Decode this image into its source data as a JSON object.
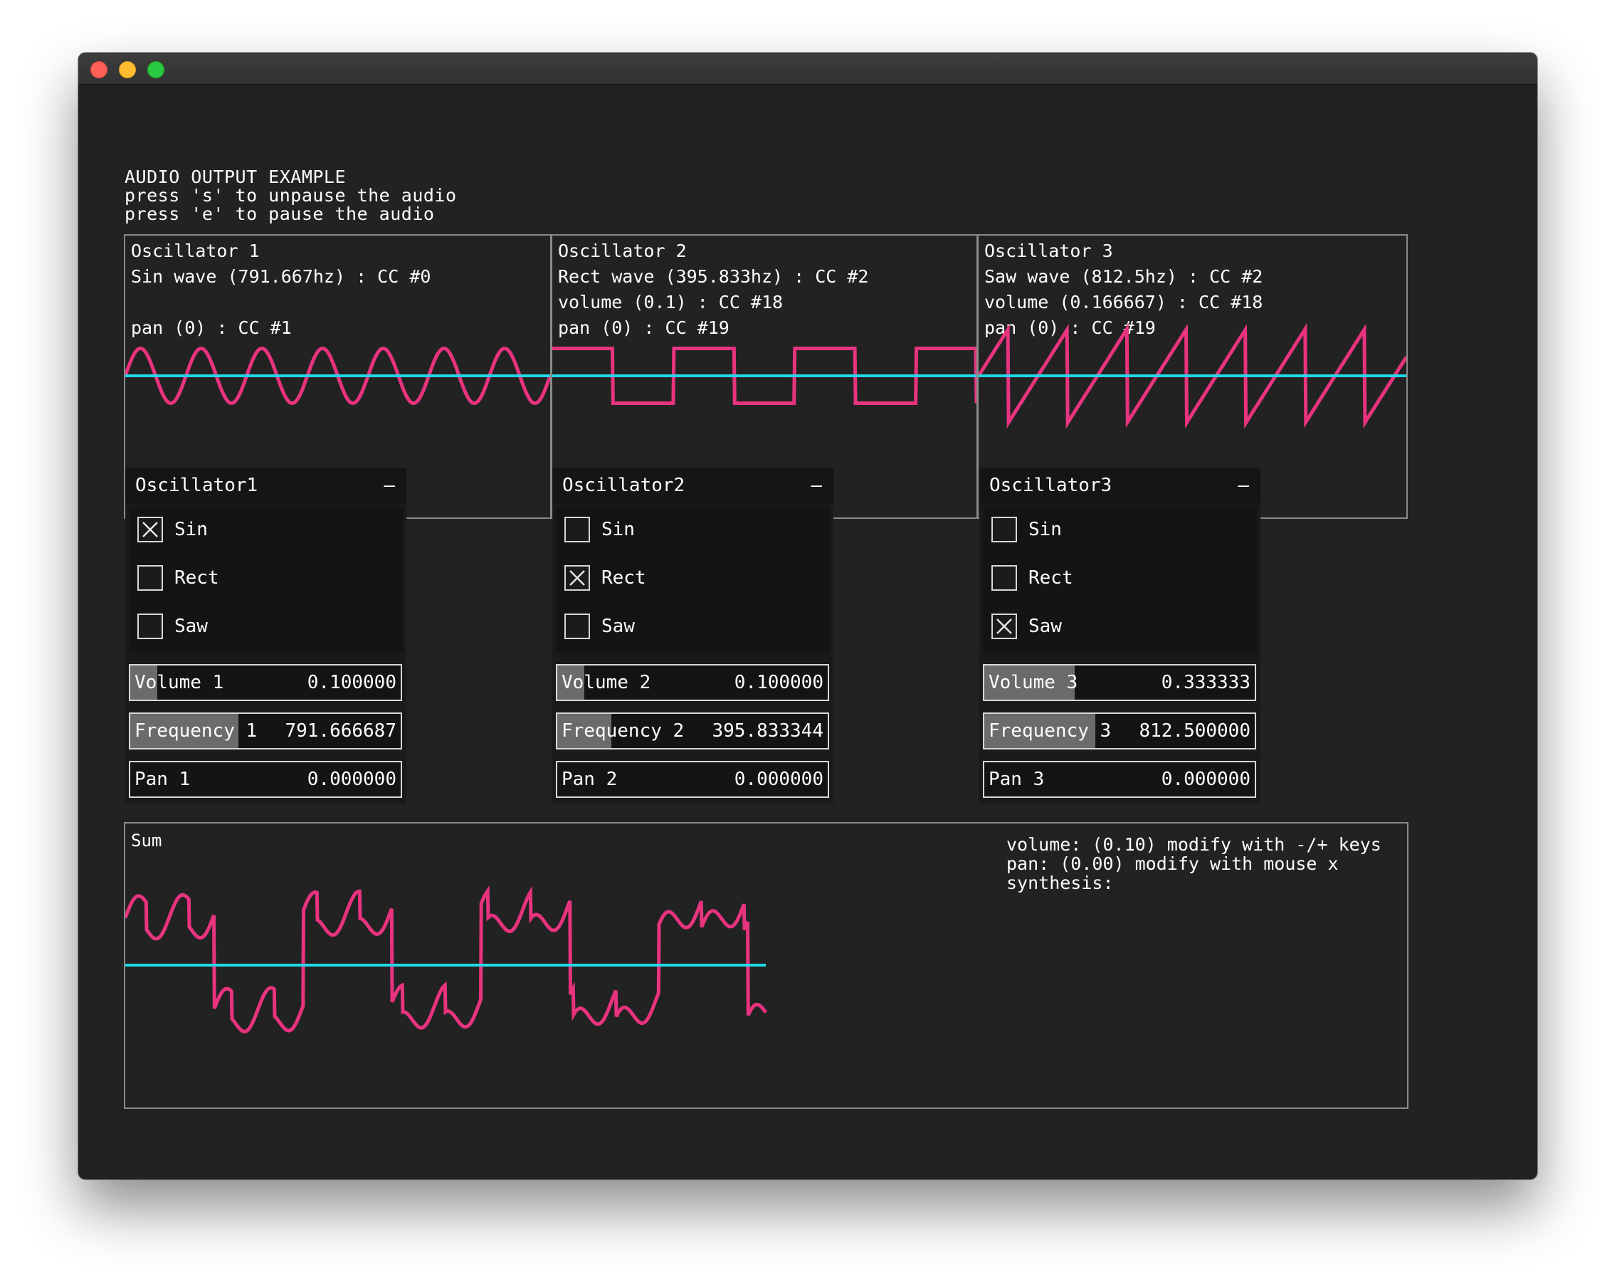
{
  "colors": {
    "wave": "#e8337f",
    "baseline": "#22d8e6",
    "border": "#8a8a8a",
    "background": "#222222"
  },
  "header": {
    "line1": "AUDIO OUTPUT EXAMPLE",
    "line2": "press 's' to unpause the audio",
    "line3": "press 'e' to pause the audio"
  },
  "scopes": [
    {
      "title": "Oscillator 1",
      "line2": "Sin wave (791.667hz) : CC #0",
      "line3": "",
      "line4": "pan (0) : CC #1",
      "wave": "sin",
      "cycles": 7,
      "amplitude": 0.35
    },
    {
      "title": "Oscillator 2",
      "line2": "Rect wave (395.833hz) : CC #2",
      "line3": "volume (0.1) : CC #18",
      "line4": "pan (0) : CC #19",
      "wave": "rect",
      "cycles": 3.5,
      "amplitude": 0.35
    },
    {
      "title": "Oscillator 3",
      "line2": "Saw wave (812.5hz) : CC #2",
      "line3": "volume (0.166667) : CC #18",
      "line4": "pan (0) : CC #19",
      "wave": "saw",
      "cycles": 7.2,
      "amplitude": 0.6
    }
  ],
  "panels": [
    {
      "title": "Oscillator1",
      "collapse": "–",
      "toggles": [
        {
          "label": "Sin",
          "checked": true
        },
        {
          "label": "Rect",
          "checked": false
        },
        {
          "label": "Saw",
          "checked": false
        }
      ],
      "sliders": [
        {
          "name": "Volume 1",
          "value": "0.100000",
          "fill": 0.1
        },
        {
          "name": "Frequency 1",
          "value": "791.666687",
          "fill": 0.4
        },
        {
          "name": "Pan 1",
          "value": "0.000000",
          "fill": 0.0
        }
      ]
    },
    {
      "title": "Oscillator2",
      "collapse": "–",
      "toggles": [
        {
          "label": "Sin",
          "checked": false
        },
        {
          "label": "Rect",
          "checked": true
        },
        {
          "label": "Saw",
          "checked": false
        }
      ],
      "sliders": [
        {
          "name": "Volume 2",
          "value": "0.100000",
          "fill": 0.1
        },
        {
          "name": "Frequency 2",
          "value": "395.833344",
          "fill": 0.2
        },
        {
          "name": "Pan 2",
          "value": "0.000000",
          "fill": 0.0
        }
      ]
    },
    {
      "title": "Oscillator3",
      "collapse": "–",
      "toggles": [
        {
          "label": "Sin",
          "checked": false
        },
        {
          "label": "Rect",
          "checked": false
        },
        {
          "label": "Saw",
          "checked": true
        }
      ],
      "sliders": [
        {
          "name": "Volume 3",
          "value": "0.333333",
          "fill": 0.333
        },
        {
          "name": "Frequency 3",
          "value": "812.500000",
          "fill": 0.41
        },
        {
          "name": "Pan 3",
          "value": "0.000000",
          "fill": 0.0
        }
      ]
    }
  ],
  "sum": {
    "title": "Sum",
    "info1": "volume: (0.10) modify with -/+ keys",
    "info2": "pan: (0.00) modify with mouse x",
    "info3": "synthesis:"
  }
}
